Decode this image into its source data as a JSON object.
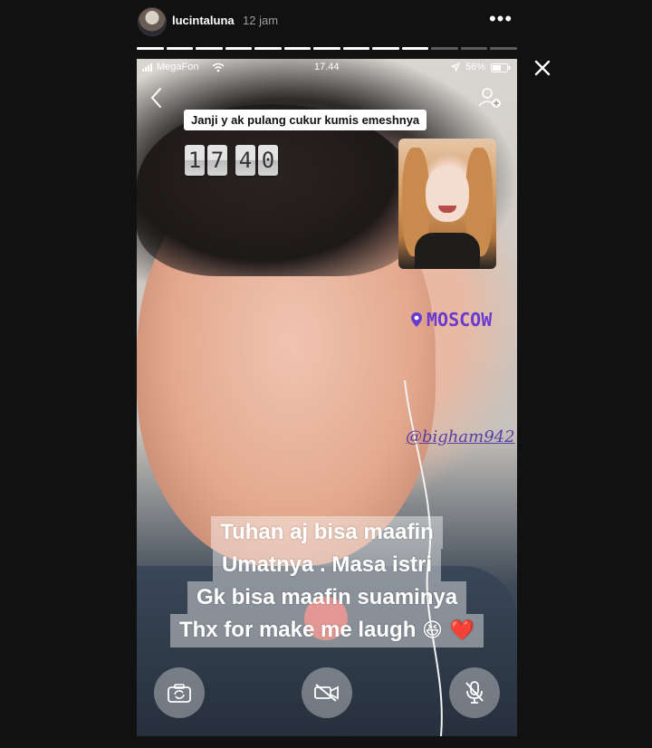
{
  "header": {
    "username": "lucintaluna",
    "timestamp": "12 jam",
    "more_icon": "ellipsis-icon",
    "more_label": "•••"
  },
  "progress": {
    "total_segments": 13,
    "active_segment": 10
  },
  "status_bar": {
    "carrier": "MegaFon",
    "time": "17.44",
    "battery": "56%"
  },
  "story": {
    "top_caption": "Janji y ak pulang cukur kumis emeshnya",
    "time_sticker": [
      "1",
      "7",
      "4",
      "0"
    ],
    "location": "MOSCOW",
    "mention": "@bigham942",
    "caption_lines": [
      "Tuhan aj bisa maafin",
      "Umatnya . Masa istri",
      "Gk bisa maafin suaminya",
      "Thx for make me laugh"
    ],
    "caption_emojis": "😆 ❤️"
  },
  "controls": {
    "flip_icon": "camera-flip-icon",
    "video_icon": "video-off-icon",
    "mute_icon": "mic-off-icon",
    "end_icon": "phone-end-icon"
  },
  "colors": {
    "background": "#111111",
    "location_purple": "#6a3ad0",
    "end_call_red": "#eb5046"
  }
}
